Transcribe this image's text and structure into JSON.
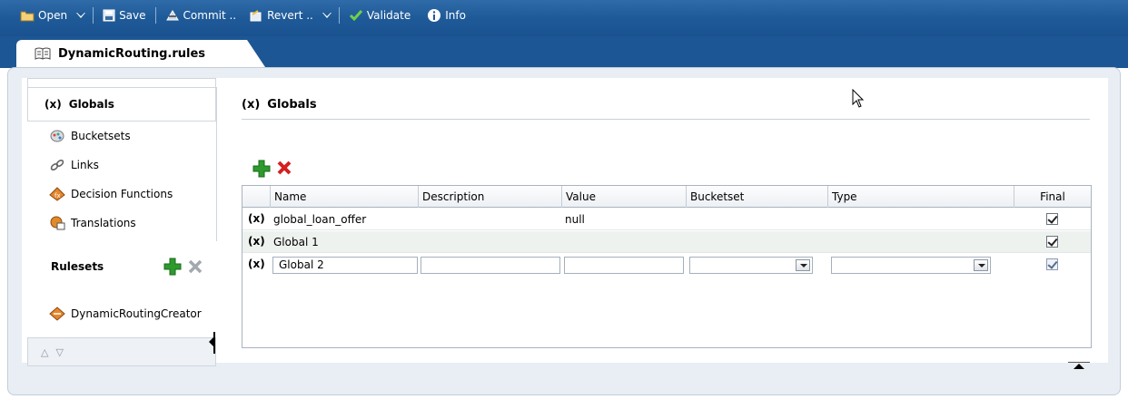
{
  "toolbar": {
    "open": "Open",
    "save": "Save",
    "commit": "Commit ..",
    "revert": "Revert ..",
    "validate": "Validate",
    "info": "Info"
  },
  "doc_tab": {
    "title": "DynamicRouting.rules"
  },
  "nav": {
    "selected": {
      "prefix": "(x)",
      "label": "Globals"
    },
    "items": [
      {
        "label": "Bucketsets",
        "icon": "bucketsets-icon"
      },
      {
        "label": "Links",
        "icon": "links-icon"
      },
      {
        "label": "Decision Functions",
        "icon": "decision-functions-icon"
      },
      {
        "label": "Translations",
        "icon": "translations-icon"
      }
    ],
    "rulesets_label": "Rulesets",
    "ruleset_item": "DynamicRoutingCreator"
  },
  "content": {
    "prefix": "(x)",
    "title": "Globals"
  },
  "grid": {
    "columns": [
      "Name",
      "Description",
      "Value",
      "Bucketset",
      "Type",
      "Final"
    ],
    "rows": [
      {
        "marker": "(x)",
        "name": "global_loan_offer",
        "description": "",
        "value": "null",
        "bucketset": "",
        "type": "",
        "final": true
      },
      {
        "marker": "(x)",
        "name": "Global 1",
        "description": "",
        "value": "",
        "bucketset": "",
        "type": "",
        "final": true
      },
      {
        "marker": "(x)",
        "name": "Global 2",
        "description": "",
        "value": "",
        "bucketset": "",
        "type": "",
        "final": true,
        "editing": true
      }
    ]
  },
  "colors": {
    "toolbar_bg": "#1f5a98",
    "frame_bg": "#e9eef5",
    "add_green": "#2e9a2e",
    "delete_red": "#d42020"
  }
}
